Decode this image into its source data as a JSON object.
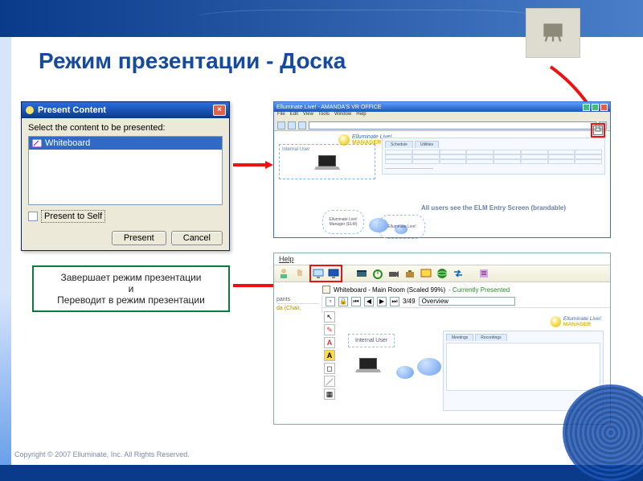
{
  "slide": {
    "title": "Режим презентации - Доска",
    "footer": "Copyright © 2007 Elluminate, Inc. All Rights Reserved."
  },
  "dialog": {
    "title": "Present Content",
    "label": "Select the content to be presented:",
    "list": {
      "item1": "Whiteboard"
    },
    "checkbox_label": "Present to Self",
    "buttons": {
      "present": "Present",
      "cancel": "Cancel"
    }
  },
  "browser1": {
    "titlebar": "Elluminate Live! - AMANDA'S VR OFFICE",
    "menu": [
      "File",
      "Edit",
      "View",
      "Tools",
      "Window",
      "Help"
    ],
    "internal_user_label": "Internal User",
    "entry_text": "All users see the ELM Entry Screen (brandable)",
    "logo_line1": "Elluminate Live!",
    "logo_line2": "MANAGER",
    "cloud1": "Elluminate Live! Manager (ELM)",
    "cloud2": "Elluminate Live!",
    "tabs": [
      "Schedule",
      "Utilities"
    ]
  },
  "greenbox": {
    "line1": "Завершает режим презентации",
    "line2": "и",
    "line3": "Переводит в режим презентации"
  },
  "shot2": {
    "help": "Help",
    "wb_title": "Whiteboard - Main Room (Scaled 99%)",
    "wb_status": " - Currently Presented",
    "participants_header": "pants",
    "participant_name": "da (Chair, ",
    "nav": {
      "page": "3/49",
      "view": "Overview"
    },
    "internal_user": "Internal User",
    "logo_line1": "Elluminate Live!",
    "logo_line2": "MANAGER",
    "panel_tabs": [
      "Meetings",
      "Recordings"
    ]
  }
}
